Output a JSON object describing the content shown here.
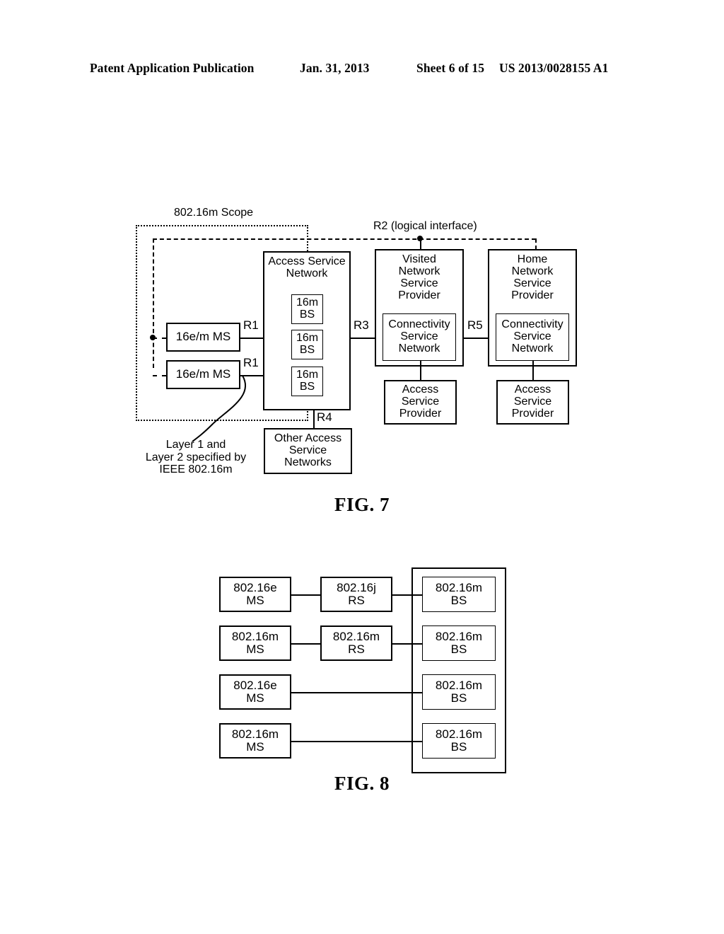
{
  "header": {
    "publication": "Patent Application Publication",
    "date": "Jan. 31, 2013",
    "sheet": "Sheet 6 of 15",
    "number": "US 2013/0028155 A1"
  },
  "figure7": {
    "caption": "FIG. 7",
    "scope_label": "802.16m Scope",
    "r2_label": "R2 (logical interface)",
    "annotation": "Layer 1 and\nLayer 2 specified by\nIEEE 802.16m",
    "ms_boxes": [
      {
        "label": "16e/m MS"
      },
      {
        "label": "16e/m MS"
      }
    ],
    "interface_labels": {
      "r1_top": "R1",
      "r1_bottom": "R1",
      "r3": "R3",
      "r4": "R4",
      "r5": "R5"
    },
    "asn": {
      "title": "Access Service\nNetwork",
      "base_stations": [
        {
          "label": "16m\nBS"
        },
        {
          "label": "16m\nBS"
        },
        {
          "label": "16m\nBS"
        }
      ]
    },
    "other_asn": {
      "label": "Other Access\nService\nNetworks"
    },
    "visited": {
      "title": "Visited\nNetwork\nService\nProvider",
      "csn": "Connectivity\nService\nNetwork",
      "asp": "Access\nService\nProvider"
    },
    "home": {
      "title": "Home\nNetwork\nService\nProvider",
      "csn": "Connectivity\nService\nNetwork",
      "asp": "Access\nService\nProvider"
    }
  },
  "figure8": {
    "caption": "FIG. 8",
    "rows": [
      {
        "ms": "802.16e\nMS",
        "rs": "802.16j\nRS",
        "bs": "802.16m\nBS"
      },
      {
        "ms": "802.16m\nMS",
        "rs": "802.16m\nRS",
        "bs": "802.16m\nBS"
      },
      {
        "ms": "802.16e\nMS",
        "rs": null,
        "bs": "802.16m\nBS"
      },
      {
        "ms": "802.16m\nMS",
        "rs": null,
        "bs": "802.16m\nBS"
      }
    ]
  }
}
